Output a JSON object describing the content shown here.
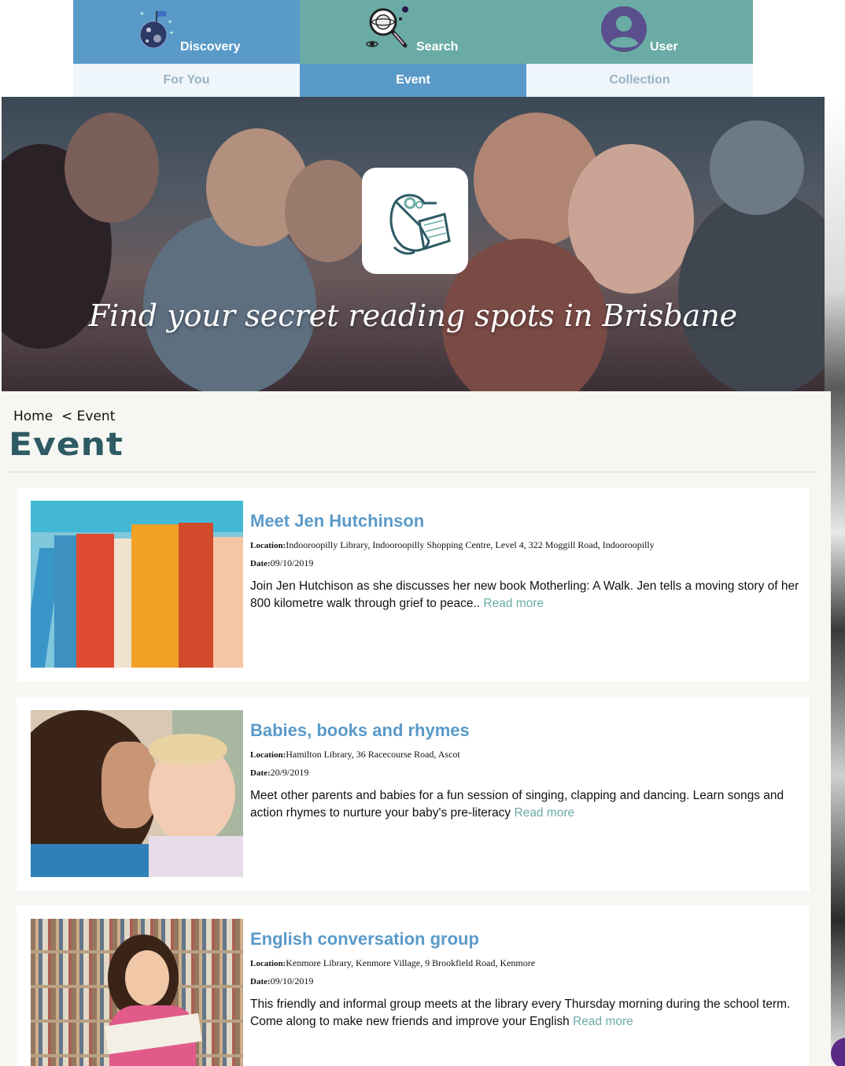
{
  "nav": {
    "tabs": [
      {
        "label": "Discovery",
        "icon": "planet-flag-icon"
      },
      {
        "label": "Search",
        "icon": "magnifier-planet-icon"
      },
      {
        "label": "User",
        "icon": "user-avatar-icon"
      }
    ],
    "subtabs": [
      {
        "label": "For You",
        "active": false
      },
      {
        "label": "Event",
        "active": true
      },
      {
        "label": "Collection",
        "active": false
      }
    ]
  },
  "hero": {
    "tagline": "Find your secret reading spots in Brisbane",
    "logo": "platypus-reading-logo"
  },
  "breadcrumb": {
    "home": "Home",
    "separator": "<",
    "current": "Event"
  },
  "page": {
    "title": "Event"
  },
  "events": [
    {
      "title": "Meet Jen Hutchinson",
      "location_label": "Location:",
      "location": "Indooroopilly Library, Indooroopilly Shopping Centre, Level 4, 322 Moggill Road, Indooroopilly",
      "date_label": "Date:",
      "date": "09/10/2019",
      "description": "Join Jen Hutchison as she discusses her new book Motherling: A Walk. Jen tells a moving story of her 800 kilometre walk through grief to peace..",
      "read_more": "Read more",
      "image": "books-on-shelf-image"
    },
    {
      "title": "Babies, books and rhymes",
      "location_label": "Location:",
      "location": "Hamilton Library, 36 Racecourse Road, Ascot",
      "date_label": "Date:",
      "date": "20/9/2019",
      "description": "Meet other parents and babies for a fun session of singing, clapping and dancing. Learn songs and action rhymes to nurture your baby's pre-literacy",
      "read_more": "Read more",
      "image": "mother-and-baby-image"
    },
    {
      "title": "English conversation group",
      "location_label": "Location:",
      "location": "Kenmore Library, Kenmore Village, 9 Brookfield Road, Kenmore",
      "date_label": "Date:",
      "date": "09/10/2019",
      "description": "This friendly and informal group meets at the library every Thursday morning during the school term. Come along to make new friends and improve your English",
      "read_more": "Read more",
      "image": "woman-reading-in-library-image"
    }
  ],
  "colors": {
    "accent_blue": "#5a9ac9",
    "accent_teal": "#6aaca5",
    "title_dark_teal": "#2e5a64"
  }
}
